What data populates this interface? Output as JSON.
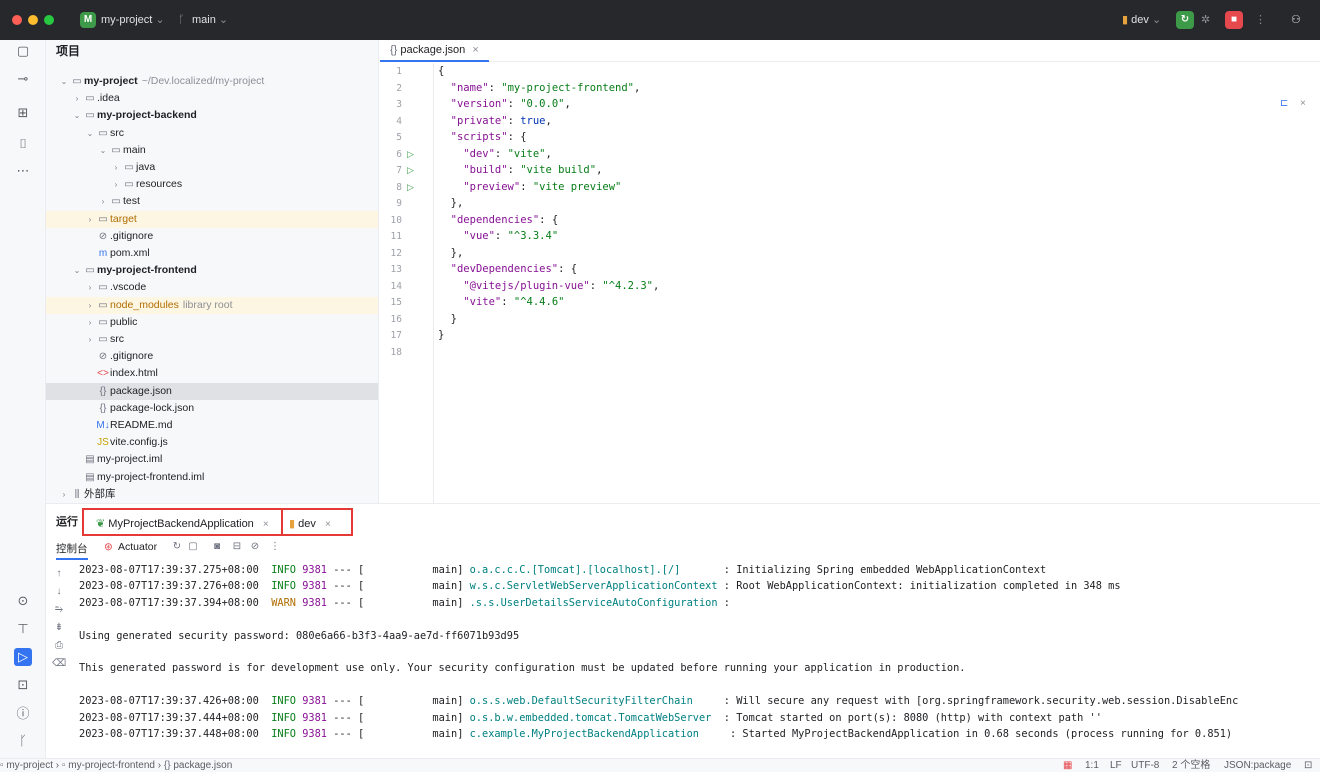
{
  "titlebar": {
    "project_badge": "M",
    "project_name": "my-project",
    "branch_icon": "git-branch-icon",
    "branch_name": "main",
    "run_config": "dev",
    "colors": {
      "red": "#ff5f57",
      "yellow": "#febc2e",
      "green": "#28c840",
      "badge_green": "#3d9a48",
      "badge_red": "#e5484d"
    }
  },
  "project_panel": {
    "title": "项目",
    "tree": [
      {
        "indent": 0,
        "chev": "v",
        "icon": "module-icon",
        "label": "my-project",
        "extra": "~/Dev.localized/my-project",
        "bold": true
      },
      {
        "indent": 1,
        "chev": ">",
        "icon": "folder-icon",
        "label": ".idea"
      },
      {
        "indent": 1,
        "chev": "v",
        "icon": "module-icon",
        "label": "my-project-backend",
        "bold": true
      },
      {
        "indent": 2,
        "chev": "v",
        "icon": "folder-icon",
        "label": "src"
      },
      {
        "indent": 3,
        "chev": "v",
        "icon": "folder-icon",
        "label": "main"
      },
      {
        "indent": 4,
        "chev": ">",
        "icon": "folder-icon",
        "label": "java"
      },
      {
        "indent": 4,
        "chev": ">",
        "icon": "folder-icon",
        "label": "resources"
      },
      {
        "indent": 3,
        "chev": ">",
        "icon": "folder-icon",
        "label": "test"
      },
      {
        "indent": 2,
        "chev": ">",
        "icon": "folder-icon",
        "label": "target",
        "excluded": true
      },
      {
        "indent": 2,
        "chev": "",
        "icon": "gitignore-icon",
        "label": ".gitignore"
      },
      {
        "indent": 2,
        "chev": "",
        "icon": "maven-icon",
        "label": "pom.xml"
      },
      {
        "indent": 1,
        "chev": "v",
        "icon": "module-icon",
        "label": "my-project-frontend",
        "bold": true
      },
      {
        "indent": 2,
        "chev": ">",
        "icon": "folder-icon",
        "label": ".vscode"
      },
      {
        "indent": 2,
        "chev": ">",
        "icon": "folder-icon",
        "label": "node_modules",
        "extra": "library root",
        "excluded": true
      },
      {
        "indent": 2,
        "chev": ">",
        "icon": "folder-icon",
        "label": "public"
      },
      {
        "indent": 2,
        "chev": ">",
        "icon": "folder-icon",
        "label": "src"
      },
      {
        "indent": 2,
        "chev": "",
        "icon": "gitignore-icon",
        "label": ".gitignore"
      },
      {
        "indent": 2,
        "chev": "",
        "icon": "html-icon",
        "label": "index.html"
      },
      {
        "indent": 2,
        "chev": "",
        "icon": "json-icon",
        "label": "package.json",
        "selected": true
      },
      {
        "indent": 2,
        "chev": "",
        "icon": "json-icon",
        "label": "package-lock.json"
      },
      {
        "indent": 2,
        "chev": "",
        "icon": "markdown-icon",
        "label": "README.md"
      },
      {
        "indent": 2,
        "chev": "",
        "icon": "js-icon",
        "label": "vite.config.js"
      },
      {
        "indent": 1,
        "chev": "",
        "icon": "iml-icon",
        "label": "my-project.iml"
      },
      {
        "indent": 1,
        "chev": "",
        "icon": "iml-icon",
        "label": "my-project-frontend.iml"
      },
      {
        "indent": 0,
        "chev": ">",
        "icon": "library-icon",
        "label": "外部库"
      }
    ]
  },
  "editor": {
    "tab_label": "package.json",
    "lines": [
      "{",
      "  \"name\": \"my-project-frontend\",",
      "  \"version\": \"0.0.0\",",
      "  \"private\": true,",
      "  \"scripts\": {",
      "    \"dev\": \"vite\",",
      "    \"build\": \"vite build\",",
      "    \"preview\": \"vite preview\"",
      "  },",
      "  \"dependencies\": {",
      "    \"vue\": \"^3.3.4\"",
      "  },",
      "  \"devDependencies\": {",
      "    \"@vitejs/plugin-vue\": \"^4.2.3\",",
      "    \"vite\": \"^4.4.6\"",
      "  }",
      "}",
      ""
    ],
    "run_lines": [
      6,
      7,
      8
    ]
  },
  "run_window": {
    "title": "运行",
    "tabs": [
      {
        "label": "MyProjectBackendApplication"
      },
      {
        "label": "dev"
      }
    ],
    "subtabs": {
      "console": "控制台",
      "actuator": "Actuator"
    },
    "log": [
      {
        "ts": "2023-08-07T17:39:37.275+08:00",
        "lvl": "INFO",
        "pid": "9381",
        "thread": "main",
        "cls": "o.a.c.c.C.[Tomcat].[localhost].[/]      ",
        "msg": "Initializing Spring embedded WebApplicationContext"
      },
      {
        "ts": "2023-08-07T17:39:37.276+08:00",
        "lvl": "INFO",
        "pid": "9381",
        "thread": "main",
        "cls": "w.s.c.ServletWebServerApplicationContext",
        "msg": "Root WebApplicationContext: initialization completed in 348 ms"
      },
      {
        "ts": "2023-08-07T17:39:37.394+08:00",
        "lvl": "WARN",
        "pid": "9381",
        "thread": "main",
        "cls": ".s.s.UserDetailsServiceAutoConfiguration",
        "msg": ""
      },
      {
        "plain": ""
      },
      {
        "plain": "Using generated security password: 080e6a66-b3f3-4aa9-ae7d-ff6071b93d95"
      },
      {
        "plain": ""
      },
      {
        "plain": "This generated password is for development use only. Your security configuration must be updated before running your application in production."
      },
      {
        "plain": ""
      },
      {
        "ts": "2023-08-07T17:39:37.426+08:00",
        "lvl": "INFO",
        "pid": "9381",
        "thread": "main",
        "cls": "o.s.s.web.DefaultSecurityFilterChain    ",
        "msg": "Will secure any request with [org.springframework.security.web.session.DisableEnc"
      },
      {
        "ts": "2023-08-07T17:39:37.444+08:00",
        "lvl": "INFO",
        "pid": "9381",
        "thread": "main",
        "cls": "o.s.b.w.embedded.tomcat.TomcatWebServer ",
        "msg": "Tomcat started on port(s): 8080 (http) with context path ''"
      },
      {
        "ts": "2023-08-07T17:39:37.448+08:00",
        "lvl": "INFO",
        "pid": "9381",
        "thread": "main",
        "cls": "c.example.MyProjectBackendApplication    ",
        "msg": "Started MyProjectBackendApplication in 0.68 seconds (process running for 0.851)"
      }
    ]
  },
  "statusbar": {
    "crumbs": [
      "my-project",
      "my-project-frontend",
      "package.json"
    ],
    "position": "1:1",
    "line_sep": "LF",
    "encoding": "UTF-8",
    "indent": "2 个空格",
    "schema": "JSON:package"
  }
}
